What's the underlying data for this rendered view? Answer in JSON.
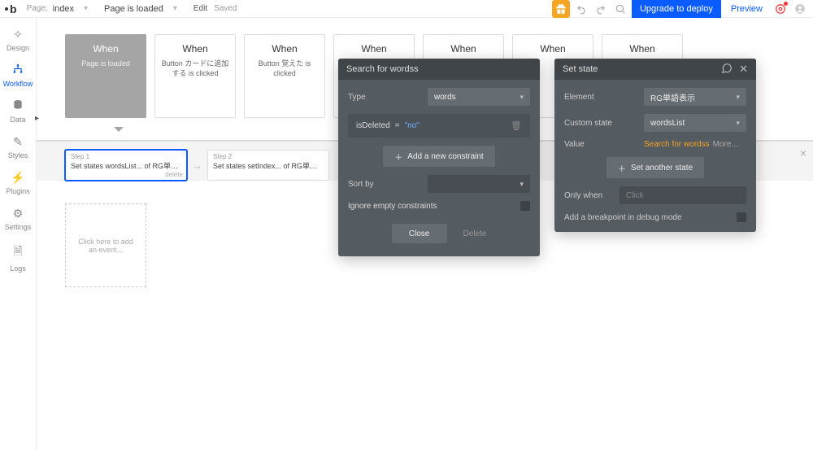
{
  "topbar": {
    "page_dropdown": {
      "label": "Page:",
      "value": "index"
    },
    "trigger_dropdown": {
      "value": "Page is loaded"
    },
    "edit_label": "Edit",
    "saved_label": "Saved",
    "deploy_label": "Upgrade to deploy",
    "preview_label": "Preview"
  },
  "sidebar": {
    "items": [
      {
        "label": "Design"
      },
      {
        "label": "Workflow"
      },
      {
        "label": "Data"
      },
      {
        "label": "Styles"
      },
      {
        "label": "Plugins"
      },
      {
        "label": "Settings"
      },
      {
        "label": "Logs"
      }
    ]
  },
  "events": [
    {
      "title": "When",
      "desc": "Page is loaded",
      "selected": true
    },
    {
      "title": "When",
      "desc": "Button カードに追加する is clicked"
    },
    {
      "title": "When",
      "desc": "Button 覚えた is clicked"
    },
    {
      "title": "When",
      "desc": ""
    },
    {
      "title": "When",
      "desc": ""
    },
    {
      "title": "When",
      "desc": ""
    },
    {
      "title": "When",
      "desc": ""
    }
  ],
  "add_event_label": "Click here to add an event...",
  "steps": [
    {
      "label": "Step 1",
      "text": "Set states wordsList... of RG単語表示",
      "delete": "delete"
    },
    {
      "label": "Step 2",
      "text": "Set states setIndex... of RG単語表示"
    }
  ],
  "search_panel": {
    "title": "Search for wordss",
    "type_label": "Type",
    "type_value": "words",
    "constraint_field": "isDeleted",
    "constraint_eq": "=",
    "constraint_value": "\"no\"",
    "add_constraint": "Add a new constraint",
    "sortby_label": "Sort by",
    "ignore_label": "Ignore empty constraints",
    "close_label": "Close",
    "delete_label": "Delete"
  },
  "state_panel": {
    "title": "Set state",
    "element_label": "Element",
    "element_value": "RG単語表示",
    "custom_state_label": "Custom state",
    "custom_state_value": "wordsList",
    "value_label": "Value",
    "value_expr": "Search for wordss",
    "value_more": "More...",
    "set_another": "Set another state",
    "only_when_label": "Only when",
    "only_when_placeholder": "Click",
    "breakpoint_label": "Add a breakpoint in debug mode"
  }
}
